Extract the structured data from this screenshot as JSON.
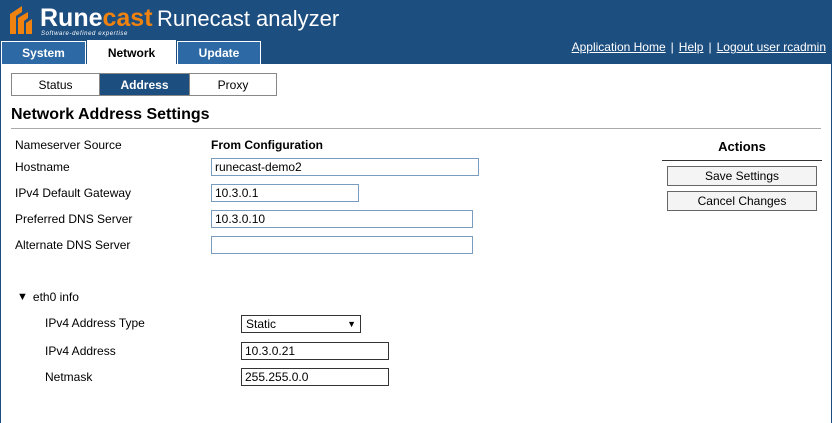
{
  "header": {
    "brand_part1": "Rune",
    "brand_part2": "cast",
    "tagline": "Software-defined expertise",
    "app_title": "Runecast analyzer",
    "accent_color": "#f0820f",
    "bg_color": "#1d4e80"
  },
  "top_tabs": [
    {
      "label": "System",
      "active": false
    },
    {
      "label": "Network",
      "active": true
    },
    {
      "label": "Update",
      "active": false
    }
  ],
  "top_links": {
    "home": "Application Home",
    "help": "Help",
    "logout": "Logout user rcadmin",
    "separator": "|"
  },
  "sub_tabs": [
    {
      "label": "Status",
      "active": false
    },
    {
      "label": "Address",
      "active": true
    },
    {
      "label": "Proxy",
      "active": false
    }
  ],
  "page_title": "Network Address Settings",
  "form": {
    "nameserver_source_label": "Nameserver Source",
    "nameserver_source_value": "From Configuration",
    "hostname_label": "Hostname",
    "hostname_value": "runecast-demo2",
    "gateway_label": "IPv4 Default Gateway",
    "gateway_value": "10.3.0.1",
    "preferred_dns_label": "Preferred DNS Server",
    "preferred_dns_value": "10.3.0.10",
    "alternate_dns_label": "Alternate DNS Server",
    "alternate_dns_value": ""
  },
  "actions": {
    "title": "Actions",
    "save_label": "Save Settings",
    "cancel_label": "Cancel Changes"
  },
  "interface": {
    "toggle_icon": "▼",
    "toggle_label": "eth0 info",
    "address_type_label": "IPv4 Address Type",
    "address_type_value": "Static",
    "address_label": "IPv4 Address",
    "address_value": "10.3.0.21",
    "netmask_label": "Netmask",
    "netmask_value": "255.255.0.0"
  }
}
